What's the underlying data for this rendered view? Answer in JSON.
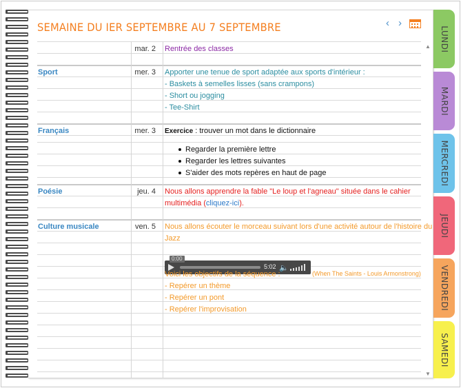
{
  "header": {
    "title": "SEMAINE DU IER SEPTEMBRE AU 7 SEPTEMBRE",
    "prev_icon": "‹",
    "next_icon": "›",
    "calendar_icon": "calendar-icon"
  },
  "tabs": [
    {
      "label": "LUNDI",
      "color": "#8cc963"
    },
    {
      "label": "MARDI",
      "color": "#b98ad6"
    },
    {
      "label": "MERCREDI",
      "color": "#6ec3ea"
    },
    {
      "label": "JEUDI",
      "color": "#f0677a"
    },
    {
      "label": "VENDREDI",
      "color": "#f6a55d"
    },
    {
      "label": "SAMEDI",
      "color": "#f7f04d"
    }
  ],
  "entries": {
    "rentree": {
      "date": "mar. 2",
      "text": "Rentrée des classes"
    },
    "sport": {
      "subject": "Sport",
      "date": "mer. 3",
      "lines": [
        "Apporter une tenue de sport adaptée aux sports d'intérieur :",
        "- Baskets à semelles lisses (sans crampons)",
        "- Short ou jogging",
        "- Tee-Shirt"
      ]
    },
    "francais": {
      "subject": "Français",
      "date": "mer. 3",
      "exercice_label": "Exercice",
      "exercice_text": " : trouver un mot dans le dictionnaire",
      "bullets": [
        "Regarder la première lettre",
        "Regarder les lettres suivantes",
        "S'aider des mots repères en haut de page"
      ]
    },
    "poesie": {
      "subject": "Poésie",
      "date": "jeu. 4",
      "line1": "Nous allons apprendre la fable \"Le loup et l'agneau\" située dans le cahier",
      "line2_prefix": "multimédia (",
      "link": "cliquez-ici",
      "line2_suffix": ")."
    },
    "musique": {
      "subject": "Culture musicale",
      "date": "ven. 5",
      "line1": "Nous allons écouter le morceau suivant lors d'une activité autour de l'histoire du",
      "line2": "Jazz",
      "player": {
        "current": "0:00",
        "duration": "5:02",
        "progress": 0
      },
      "track_caption": "(When The Saints - Louis Armonstrong)",
      "objectives_title": "Voici les objectifs de la séquence :",
      "objectives": [
        "- Repérer un thème",
        "- Repérer un pont",
        "- Repérer l'improvisation"
      ]
    }
  }
}
